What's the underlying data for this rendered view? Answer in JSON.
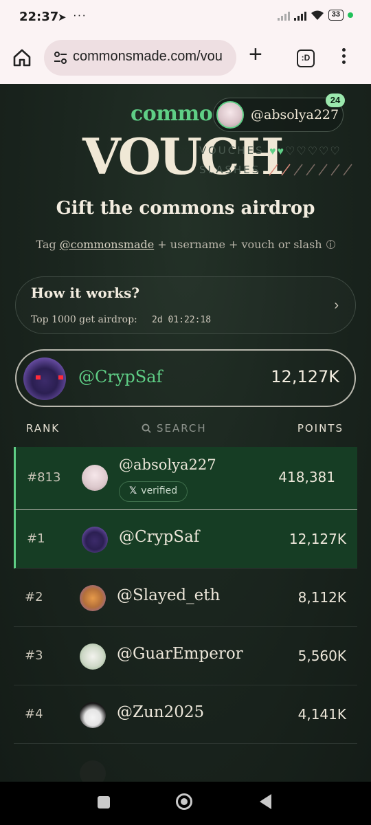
{
  "status": {
    "time": "22:37",
    "battery": "33",
    "more": "···"
  },
  "browser": {
    "url": "commonsmade.com/vou",
    "tabs_label": ":D"
  },
  "hero": {
    "brand_top": "commo",
    "brand_main": "VOUCH",
    "user_handle": "@absolya227",
    "notification_count": "24",
    "vouches_label": "VOUCHES",
    "slashes_label": "SLASHES",
    "vouches_filled": 2,
    "vouches_total": 7
  },
  "headline": "Gift the commons airdrop",
  "subline": {
    "tag": "@commonsmade",
    "rest": " + username + vouch or slash"
  },
  "how_it_works": {
    "title": "How it works?",
    "subtitle": "Top 1000 get airdrop:",
    "timer": "2d 01:22:18"
  },
  "my_card": {
    "handle": "@CrypSaf",
    "points": "12,127K"
  },
  "table": {
    "rank_header": "RANK",
    "search_placeholder": "SEARCH",
    "points_header": "POINTS",
    "self_row": {
      "rank": "#813",
      "handle": "@absolya227",
      "badge": "verified",
      "points": "418,381"
    },
    "rows": [
      {
        "rank": "#1",
        "handle": "@CrypSaf",
        "points": "12,127K"
      },
      {
        "rank": "#2",
        "handle": "@Slayed_eth",
        "points": "8,112K"
      },
      {
        "rank": "#3",
        "handle": "@GuarEmperor",
        "points": "5,560K"
      },
      {
        "rank": "#4",
        "handle": "@Zun2025",
        "points": "4,141K"
      }
    ]
  },
  "colors": {
    "accent_green": "#5fcf86",
    "background": "#1b261f",
    "highlight_row": "#163d24"
  }
}
